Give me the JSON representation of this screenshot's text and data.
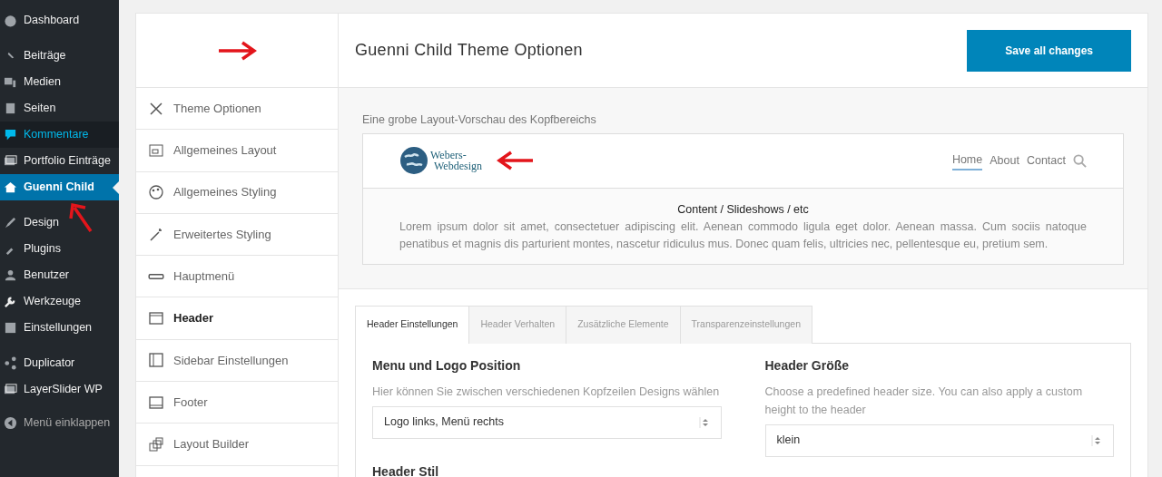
{
  "admin_menu_groups": [
    {
      "items": [
        {
          "label": "Dashboard",
          "selected": false,
          "highlighted": false
        }
      ]
    },
    {
      "items": [
        {
          "label": "Beiträge",
          "selected": false,
          "highlighted": false
        },
        {
          "label": "Medien",
          "selected": false,
          "highlighted": false
        },
        {
          "label": "Seiten",
          "selected": false,
          "highlighted": false
        },
        {
          "label": "Kommentare",
          "selected": false,
          "highlighted": true
        },
        {
          "label": "Portfolio Einträge",
          "selected": false,
          "highlighted": false
        },
        {
          "label": "Guenni Child",
          "selected": true,
          "highlighted": false
        }
      ]
    },
    {
      "items": [
        {
          "label": "Design",
          "selected": false,
          "highlighted": false
        },
        {
          "label": "Plugins",
          "selected": false,
          "highlighted": false
        },
        {
          "label": "Benutzer",
          "selected": false,
          "highlighted": false
        },
        {
          "label": "Werkzeuge",
          "selected": false,
          "highlighted": false
        },
        {
          "label": "Einstellungen",
          "selected": false,
          "highlighted": false
        }
      ]
    },
    {
      "items": [
        {
          "label": "Duplicator",
          "selected": false,
          "highlighted": false
        },
        {
          "label": "LayerSlider WP",
          "selected": false,
          "highlighted": false
        }
      ]
    }
  ],
  "collapse_menu": {
    "label": "Menü einklappen"
  },
  "options_nav": [
    {
      "label": "Theme Optionen",
      "selected": false
    },
    {
      "label": "Allgemeines Layout",
      "selected": false
    },
    {
      "label": "Allgemeines Styling",
      "selected": false
    },
    {
      "label": "Erweitertes Styling",
      "selected": false
    },
    {
      "label": "Hauptmenü",
      "selected": false
    },
    {
      "label": "Header",
      "selected": true
    },
    {
      "label": "Sidebar Einstellungen",
      "selected": false
    },
    {
      "label": "Footer",
      "selected": false
    },
    {
      "label": "Layout Builder",
      "selected": false
    }
  ],
  "page_title": "Guenni Child Theme Optionen",
  "save_button": "Save all changes",
  "preview": {
    "caption": "Eine grobe Layout-Vorschau des Kopfbereichs",
    "logo_lines": [
      "Webers-",
      "Webdesign"
    ],
    "nav": [
      {
        "label": "Home",
        "selected": true
      },
      {
        "label": "About",
        "selected": false
      },
      {
        "label": "Contact",
        "selected": false
      }
    ],
    "content_title": "Content / Slideshows / etc",
    "content_text": "Lorem ipsum dolor sit amet, consectetuer adipiscing elit. Aenean commodo ligula eget dolor. Aenean massa. Cum sociis natoque penatibus et magnis dis parturient montes, nascetur ridiculus mus. Donec quam felis, ultricies nec, pellentesque eu, pretium sem."
  },
  "tabs": [
    {
      "label": "Header Einstellungen",
      "selected": true
    },
    {
      "label": "Header Verhalten",
      "selected": false
    },
    {
      "label": "Zusätzliche Elemente",
      "selected": false
    },
    {
      "label": "Transparenzeinstellungen",
      "selected": false
    }
  ],
  "fields": [
    {
      "label": "Menu und Logo Position",
      "description": "Hier können Sie zwischen verschiedenen Kopfzeilen Designs wählen",
      "value": "Logo links, Menü rechts"
    },
    {
      "label": "Header Größe",
      "description": "Choose a predefined header size. You can also apply a custom height to the header",
      "value": "klein"
    }
  ],
  "next_heading": "Header Stil"
}
